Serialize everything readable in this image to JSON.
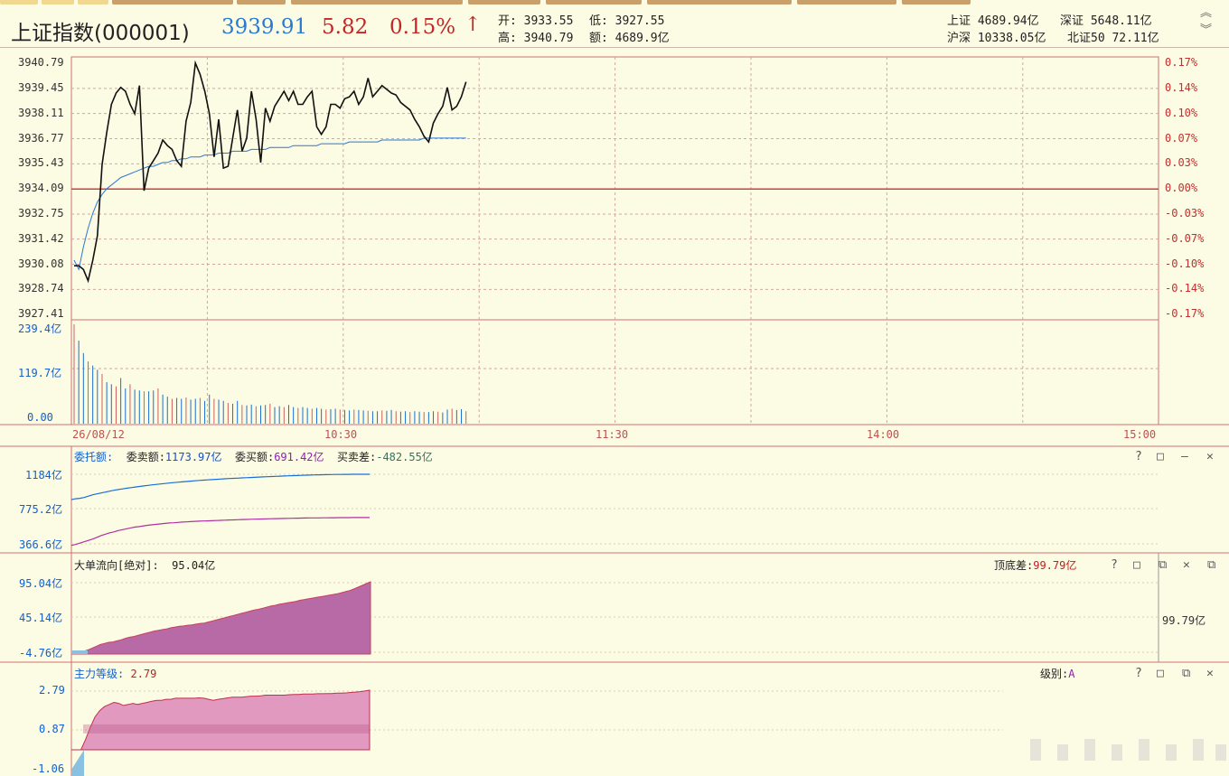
{
  "header": {
    "index_name": "上证指数(000001)",
    "price": "3939.91",
    "change": "5.82",
    "change_pct": "0.15%",
    "arrow": "↑",
    "open_label": "开:",
    "open": "3933.55",
    "low_label": "低:",
    "low": "3927.55",
    "high_label": "高:",
    "high": "3940.79",
    "amount_label": "额:",
    "amount": "4689.9亿",
    "markets": [
      {
        "label": "上证",
        "value": "4689.94亿"
      },
      {
        "label": "深证",
        "value": "5648.11亿"
      },
      {
        "label": "沪深",
        "value": "10338.05亿"
      },
      {
        "label": "北证50",
        "value": "72.11亿"
      }
    ]
  },
  "price_chart": {
    "y_labels": [
      "3940.79",
      "3939.45",
      "3938.11",
      "3936.77",
      "3935.43",
      "3934.09",
      "3932.75",
      "3931.42",
      "3930.08",
      "3928.74",
      "3927.41"
    ],
    "pct_labels": [
      "0.17%",
      "0.14%",
      "0.10%",
      "0.07%",
      "0.03%",
      "0.00%",
      "-0.03%",
      "-0.07%",
      "-0.10%",
      "-0.14%",
      "-0.17%"
    ],
    "prev_close": 3934.09,
    "series_price": [
      3930.0,
      3930.0,
      3929.8,
      3929.2,
      3930.3,
      3931.6,
      3935.4,
      3937.1,
      3938.6,
      3939.2,
      3939.5,
      3939.3,
      3938.6,
      3938.1,
      3939.6,
      3934.0,
      3935.2,
      3935.6,
      3936.0,
      3936.7,
      3936.4,
      3936.2,
      3935.6,
      3935.3,
      3937.7,
      3938.7,
      3940.8,
      3940.2,
      3939.3,
      3938.1,
      3935.8,
      3937.8,
      3935.2,
      3935.3,
      3936.8,
      3938.3,
      3936.1,
      3936.8,
      3939.3,
      3937.8,
      3935.5,
      3938.4,
      3937.7,
      3938.5,
      3938.9,
      3939.3,
      3938.8,
      3939.3,
      3938.6,
      3938.6,
      3939.0,
      3939.3,
      3937.4,
      3937.0,
      3937.4,
      3938.6,
      3938.6,
      3938.4,
      3938.9,
      3939.0,
      3939.3,
      3938.6,
      3939.0,
      3940.0,
      3939.0,
      3939.3,
      3939.6,
      3939.4,
      3939.2,
      3939.1,
      3938.7,
      3938.5,
      3938.3,
      3937.8,
      3937.4,
      3936.9,
      3936.6,
      3937.6,
      3938.1,
      3938.5,
      3939.5,
      3938.3,
      3938.5,
      3939.0,
      3939.8
    ],
    "series_avg": [
      3930.3,
      3929.8,
      3931.0,
      3932.0,
      3932.8,
      3933.4,
      3933.8,
      3934.1,
      3934.3,
      3934.5,
      3934.7,
      3934.8,
      3934.9,
      3935.0,
      3935.1,
      3935.2,
      3935.3,
      3935.3,
      3935.4,
      3935.5,
      3935.5,
      3935.6,
      3935.6,
      3935.7,
      3935.7,
      3935.8,
      3935.8,
      3935.8,
      3935.9,
      3935.9,
      3935.9,
      3936.0,
      3936.0,
      3936.0,
      3936.1,
      3936.1,
      3936.1,
      3936.1,
      3936.2,
      3936.2,
      3936.2,
      3936.2,
      3936.3,
      3936.3,
      3936.3,
      3936.3,
      3936.3,
      3936.4,
      3936.4,
      3936.4,
      3936.4,
      3936.4,
      3936.4,
      3936.5,
      3936.5,
      3936.5,
      3936.5,
      3936.5,
      3936.5,
      3936.6,
      3936.6,
      3936.6,
      3936.6,
      3936.6,
      3936.6,
      3936.6,
      3936.7,
      3936.7,
      3936.7,
      3936.7,
      3936.7,
      3936.7,
      3936.7,
      3936.7,
      3936.7,
      3936.8,
      3936.8,
      3936.8,
      3936.8,
      3936.8,
      3936.8,
      3936.8,
      3936.8,
      3936.8,
      3936.8
    ]
  },
  "volume": {
    "y_labels": [
      "239.4亿",
      "119.7亿",
      "0.00"
    ],
    "max": 239.4,
    "bars": [
      239.4,
      200,
      170,
      150,
      140,
      130,
      120,
      100,
      95,
      90,
      110,
      85,
      95,
      82,
      80,
      78,
      78,
      80,
      85,
      70,
      65,
      60,
      62,
      60,
      63,
      58,
      60,
      62,
      55,
      70,
      60,
      58,
      55,
      50,
      48,
      55,
      45,
      44,
      46,
      42,
      44,
      45,
      48,
      40,
      42,
      40,
      45,
      40,
      38,
      40,
      38,
      36,
      38,
      36,
      34,
      35,
      36,
      34,
      33,
      32,
      34,
      33,
      32,
      31,
      30,
      30,
      32,
      31,
      33,
      30,
      29,
      30,
      28,
      30,
      29,
      28,
      28,
      30,
      29,
      27,
      34,
      36,
      33,
      35,
      30
    ]
  },
  "time_axis": {
    "labels": [
      "26/08/12",
      "10:30",
      "11:30",
      "14:00",
      "15:00"
    ]
  },
  "panel_orders": {
    "name": "委托额:",
    "sell_label": "委卖额:",
    "sell_value": "1173.97亿",
    "buy_label": "委买额:",
    "buy_value": "691.42亿",
    "diff_label": "买卖差:",
    "diff_value": "-482.55亿",
    "y_labels": [
      "1184亿",
      "775.2亿",
      "366.6亿"
    ],
    "ymin": 366.6,
    "ymax": 1184,
    "series_sell": [
      890,
      900,
      905,
      915,
      930,
      945,
      955,
      965,
      975,
      985,
      995,
      1003,
      1010,
      1018,
      1025,
      1032,
      1038,
      1044,
      1050,
      1056,
      1061,
      1066,
      1071,
      1076,
      1081,
      1085,
      1089,
      1093,
      1097,
      1101,
      1105,
      1108,
      1111,
      1114,
      1117,
      1120,
      1123,
      1126,
      1129,
      1131,
      1134,
      1136,
      1138,
      1140,
      1143,
      1145,
      1147,
      1149,
      1151,
      1153,
      1155,
      1157,
      1159,
      1160,
      1162,
      1164,
      1165,
      1167,
      1168,
      1169,
      1170,
      1171,
      1172,
      1172,
      1173,
      1173,
      1174,
      1174,
      1174,
      1174,
      1174
    ],
    "series_buy": [
      380,
      390,
      405,
      420,
      435,
      450,
      470,
      490,
      505,
      520,
      530,
      545,
      555,
      565,
      575,
      585,
      590,
      598,
      605,
      610,
      615,
      620,
      625,
      630,
      632,
      636,
      640,
      642,
      645,
      648,
      650,
      652,
      653,
      655,
      657,
      659,
      661,
      663,
      664,
      666,
      668,
      669,
      671,
      672,
      673,
      674,
      676,
      677,
      678,
      679,
      680,
      681,
      682,
      683,
      684,
      685,
      686,
      686,
      687,
      688,
      688,
      689,
      689,
      690,
      690,
      690,
      691,
      691,
      691,
      691,
      691
    ]
  },
  "panel_bigorder": {
    "name": "大单流向[绝对]:",
    "value": "95.04亿",
    "top_label": "顶底差:",
    "top_value": "99.79亿",
    "right_value": "99.79亿",
    "y_labels": [
      "95.04亿",
      "45.14亿",
      "-4.76亿"
    ],
    "ymin": -4.76,
    "ymax": 95.04,
    "series": [
      -4.76,
      -4.5,
      -3.0,
      -1.0,
      1.0,
      3.5,
      6.0,
      8.5,
      10.0,
      11.5,
      12.0,
      13.5,
      15.0,
      17.0,
      18.5,
      19.5,
      21.0,
      22.5,
      24.0,
      25.5,
      27.0,
      28.0,
      29.0,
      30.0,
      31.5,
      32.5,
      33.5,
      34.0,
      35.0,
      35.5,
      36.5,
      37.5,
      38.0,
      39.5,
      41.0,
      42.5,
      44.0,
      45.5,
      47.0,
      48.5,
      50.0,
      51.5,
      53.0,
      54.5,
      56.0,
      57.0,
      58.5,
      60.0,
      61.5,
      62.5,
      64.0,
      65.0,
      66.0,
      67.0,
      68.0,
      69.5,
      70.5,
      71.5,
      72.5,
      73.5,
      74.5,
      75.5,
      76.5,
      77.5,
      78.5,
      80.0,
      81.5,
      83.0,
      85.0,
      87.5,
      90.0,
      92.5,
      95.04
    ]
  },
  "panel_mainforce": {
    "name": "主力等级:",
    "value": "2.79",
    "level_label": "级别:",
    "level_value": "A",
    "y_labels": [
      "2.79",
      "0.87",
      "-1.06"
    ],
    "ymin": -1.06,
    "ymax": 2.79,
    "series": [
      -1.06,
      -0.6,
      -0.2,
      0.4,
      1.0,
      1.5,
      1.8,
      2.0,
      2.1,
      2.2,
      2.15,
      2.05,
      2.1,
      2.15,
      2.1,
      2.15,
      2.2,
      2.25,
      2.3,
      2.3,
      2.35,
      2.35,
      2.4,
      2.4,
      2.4,
      2.4,
      2.4,
      2.42,
      2.4,
      2.35,
      2.3,
      2.35,
      2.38,
      2.42,
      2.45,
      2.45,
      2.45,
      2.48,
      2.5,
      2.5,
      2.52,
      2.55,
      2.55,
      2.55,
      2.55,
      2.55,
      2.57,
      2.58,
      2.58,
      2.6,
      2.6,
      2.6,
      2.62,
      2.62,
      2.63,
      2.63,
      2.65,
      2.65,
      2.66,
      2.68,
      2.7,
      2.72,
      2.75,
      2.79
    ]
  },
  "controls": {
    "help": "?",
    "max": "□",
    "min": "—",
    "restore": "⧉",
    "close": "✕"
  },
  "colors": {
    "price_line": "#111111",
    "avg_line": "#2a78d8",
    "grid": "#e0a0a0",
    "frame": "#d07070",
    "sell_line": "#1a6ed8",
    "buy_line": "#b030a0",
    "area_fill": "#b86aa6",
    "area_fill2": "#c8629e",
    "main_dark": "#b85a84",
    "main_light": "#e199c0"
  }
}
